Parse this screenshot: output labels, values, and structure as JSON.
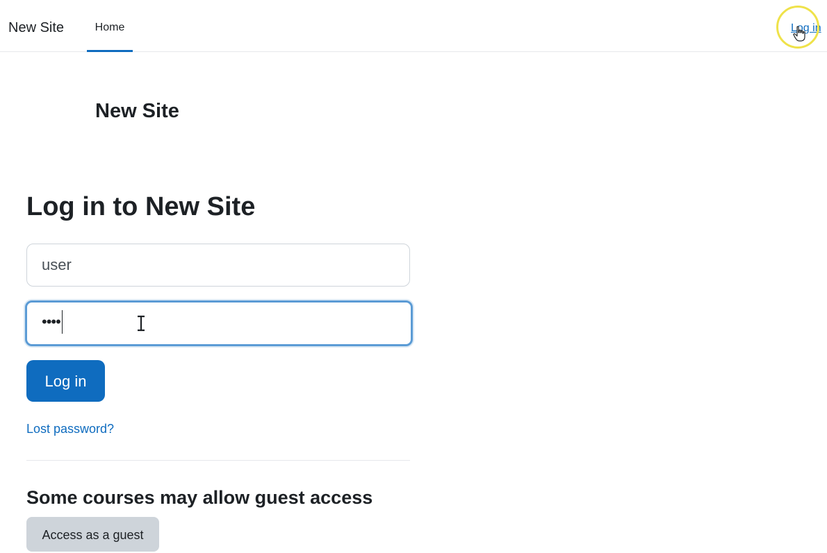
{
  "navbar": {
    "brand": "New Site",
    "items": [
      {
        "label": "Home",
        "active": true
      }
    ],
    "login_link": "Log in",
    "accent_color": "#0f6cbf"
  },
  "page": {
    "site_title": "New Site"
  },
  "login": {
    "heading": "Log in to New Site",
    "username_value": "user",
    "password_masked": "••••",
    "submit_label": "Log in",
    "lost_password": "Lost password?"
  },
  "guest": {
    "heading": "Some courses may allow guest access",
    "button_label": "Access as a guest"
  },
  "overlays": {
    "click_highlight_icon": "click-highlight-circle",
    "pointer_icon": "hand-pointer-icon",
    "text_cursor_icon": "i-beam-cursor-icon"
  }
}
